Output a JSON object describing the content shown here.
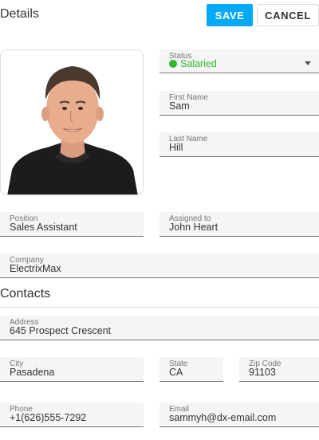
{
  "header": {
    "title": "Details",
    "save_label": "SAVE",
    "cancel_label": "CANCEL"
  },
  "colors": {
    "accent": "#03a9f4",
    "status_green": "#2eb82e"
  },
  "details": {
    "status": {
      "label": "Status",
      "value": "Salaried"
    },
    "first_name": {
      "label": "First Name",
      "value": "Sam"
    },
    "last_name": {
      "label": "Last Name",
      "value": "Hill"
    },
    "position": {
      "label": "Position",
      "value": "Sales Assistant"
    },
    "assigned_to": {
      "label": "Assigned to",
      "value": "John Heart"
    },
    "company": {
      "label": "Company",
      "value": "ElectrixMax"
    }
  },
  "contacts": {
    "title": "Contacts",
    "address": {
      "label": "Address",
      "value": "645 Prospect Crescent"
    },
    "city": {
      "label": "City",
      "value": "Pasadena"
    },
    "state": {
      "label": "State",
      "value": "CA"
    },
    "zip": {
      "label": "Zip Code",
      "value": "91103"
    },
    "phone": {
      "label": "Phone",
      "value": "+1(626)555-7292"
    },
    "email": {
      "label": "Email",
      "value": "sammyh@dx-email.com"
    }
  }
}
